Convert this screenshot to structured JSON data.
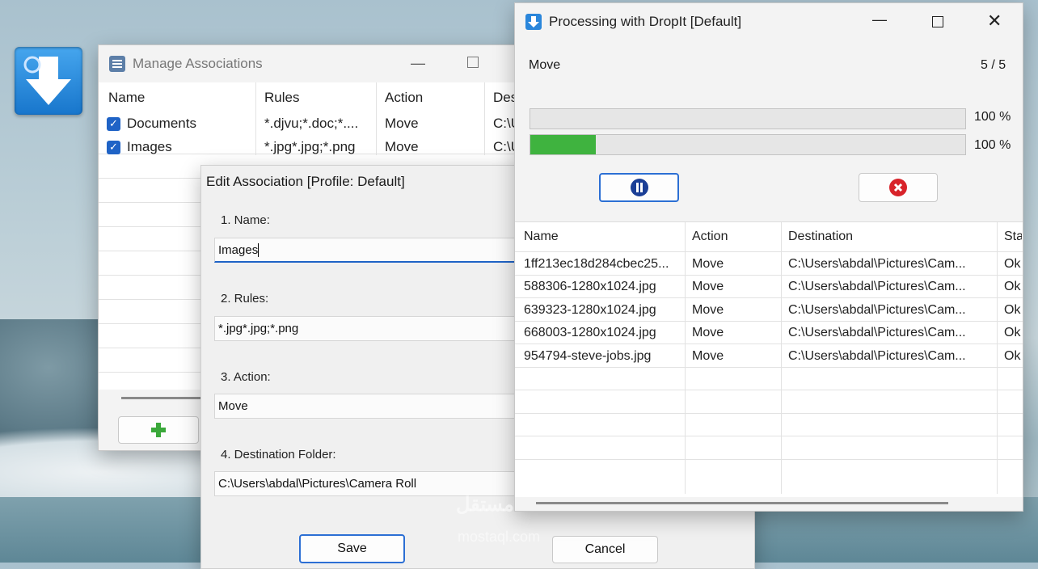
{
  "manage": {
    "title": "Manage Associations",
    "columns": [
      "Name",
      "Rules",
      "Action",
      "Des"
    ],
    "rows": [
      {
        "name": "Documents",
        "rules": "*.djvu;*.doc;*....",
        "action": "Move",
        "dest": "C:\\U"
      },
      {
        "name": "Images",
        "rules": "*.jpg*.jpg;*.png",
        "action": "Move",
        "dest": "C:\\U"
      }
    ]
  },
  "edit": {
    "title": "Edit Association [Profile: Default]",
    "name_label": "1. Name:",
    "name_value": "Images",
    "rules_label": "2. Rules:",
    "rules_value": "*.jpg*.jpg;*.png",
    "action_label": "3. Action:",
    "action_value": "Move",
    "dest_label": "4. Destination Folder:",
    "dest_value": "C:\\Users\\abdal\\Pictures\\Camera Roll",
    "save": "Save",
    "cancel": "Cancel"
  },
  "proc": {
    "title": "Processing with DropIt [Default]",
    "status": "Move",
    "count": "5 / 5",
    "bar1_text": "100 %",
    "bar1_progress": 1.0,
    "bar2_text": "100 %",
    "bar2_fill_visible": 0.15,
    "columns": [
      "Name",
      "Action",
      "Destination",
      "Sta"
    ],
    "rows": [
      {
        "name": "1ff213ec18d284cbec25...",
        "action": "Move",
        "dest": "C:\\Users\\abdal\\Pictures\\Cam...",
        "status": "Ok"
      },
      {
        "name": "588306-1280x1024.jpg",
        "action": "Move",
        "dest": "C:\\Users\\abdal\\Pictures\\Cam...",
        "status": "Ok"
      },
      {
        "name": "639323-1280x1024.jpg",
        "action": "Move",
        "dest": "C:\\Users\\abdal\\Pictures\\Cam...",
        "status": "Ok"
      },
      {
        "name": "668003-1280x1024.jpg",
        "action": "Move",
        "dest": "C:\\Users\\abdal\\Pictures\\Cam...",
        "status": "Ok"
      },
      {
        "name": "954794-steve-jobs.jpg",
        "action": "Move",
        "dest": "C:\\Users\\abdal\\Pictures\\Cam...",
        "status": "Ok"
      }
    ]
  },
  "watermark": {
    "arabic": "مستقل",
    "latin": "mostaql.com"
  },
  "colors": {
    "accent": "#1f63c6",
    "progress": "#3fb33f",
    "cancel_icon": "#d8232a"
  },
  "icons": [
    "dropit-icon",
    "minimize-icon",
    "maximize-icon",
    "close-icon",
    "pause-icon",
    "stop-icon",
    "plus-icon",
    "checkbox-icon"
  ]
}
